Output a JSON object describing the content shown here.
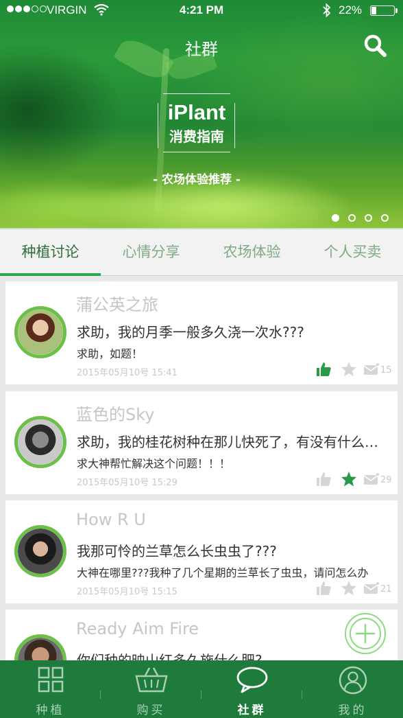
{
  "status_bar": {
    "carrier": "VIRGIN",
    "time": "4:21 PM",
    "battery_text": "22%",
    "battery_level": 0.22
  },
  "nav": {
    "title": "社群",
    "search_icon": "search-icon"
  },
  "banner": {
    "brand": "iPlant",
    "subtitle": "消费指南",
    "tagline": "- 农场体验推荐 -",
    "pages": 4,
    "active_page": 1
  },
  "tabs": [
    {
      "label": "种植讨论",
      "active": true
    },
    {
      "label": "心情分享",
      "active": false
    },
    {
      "label": "农场体验",
      "active": false
    },
    {
      "label": "个人买卖",
      "active": false
    }
  ],
  "posts": [
    {
      "user": "蒲公英之旅",
      "title": "求助，我的月季一般多久浇一次水???",
      "body": "求助，如题！",
      "date": "2015年05月10号  15:41",
      "liked": true,
      "starred": false,
      "comments": "15"
    },
    {
      "user": "蓝色的Sky",
      "title": "求助，我的桂花树种在那儿快死了，有没有什么办法",
      "body": "求大神帮忙解决这个问题！！！",
      "date": "2015年05月10号  15:29",
      "liked": false,
      "starred": true,
      "comments": "29"
    },
    {
      "user": "How R U",
      "title": "我那可怜的兰草怎么长虫虫了???",
      "body": "大神在哪里???我种了几个星期的兰草长了虫虫，请问怎么办",
      "date": "2015年05月10号  15:15",
      "liked": false,
      "starred": false,
      "comments": "21"
    },
    {
      "user": "Ready Aim Fire",
      "title": "你们种的映山红多久施什么肥?",
      "body": "",
      "date": "",
      "liked": false,
      "starred": false,
      "comments": ""
    }
  ],
  "bottom_nav": [
    {
      "label": "种植",
      "icon": "grid-icon",
      "active": false
    },
    {
      "label": "购买",
      "icon": "basket-icon",
      "active": false
    },
    {
      "label": "社群",
      "icon": "chat-bubble-icon",
      "active": true
    },
    {
      "label": "我的",
      "icon": "user-icon",
      "active": false
    }
  ],
  "colors": {
    "brand_green": "#1f7b3c",
    "accent_green": "#2aa84a",
    "avatar_ring": "#6cc04a"
  }
}
